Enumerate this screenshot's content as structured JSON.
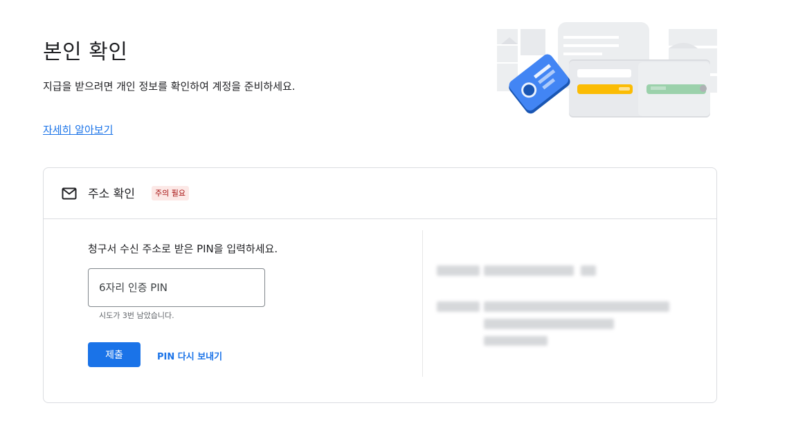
{
  "header": {
    "title": "본인 확인",
    "description": "지급을 받으려면 개인 정보를 확인하여 계정을 준비하세요.",
    "learn_more": "자세히 알아보기"
  },
  "address_card": {
    "title": "주소 확인",
    "badge": "주의 필요",
    "instruction": "청구서 수신 주소로 받은 PIN을 입력하세요.",
    "pin_input": {
      "placeholder": "6자리 인증 PIN",
      "value": ""
    },
    "attempts_left": "시도가 3번 남았습니다.",
    "submit_label": "제출",
    "resend_label": "PIN 다시 보내기"
  },
  "colors": {
    "accent": "#1a73e8",
    "badge_bg": "#fce8e6",
    "badge_text": "#a50e0e",
    "border": "#dadce0"
  },
  "icons": {
    "mail": "mail-icon",
    "hero": "wallet-id-card-illustration"
  }
}
